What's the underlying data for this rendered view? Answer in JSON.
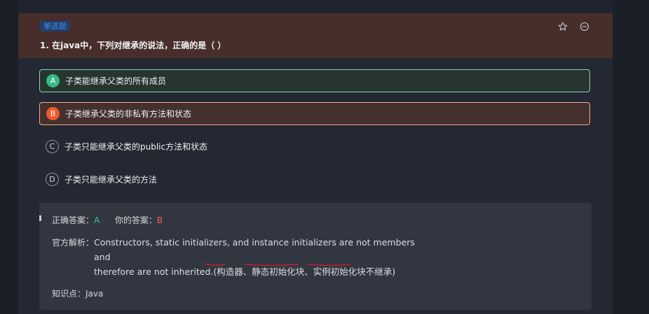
{
  "question": {
    "type_badge": "单选题",
    "title": "1. 在java中，下列对继承的说法，正确的是（ ）",
    "star_icon": "star-outline-icon",
    "remove_icon": "minus-circle-icon"
  },
  "options": [
    {
      "letter": "A",
      "text": "子类能继承父类的所有成员",
      "state": "correct"
    },
    {
      "letter": "B",
      "text": "子类继承父类的非私有方法和状态",
      "state": "selected-wrong"
    },
    {
      "letter": "C",
      "text": "子类只能继承父类的public方法和状态",
      "state": "default"
    },
    {
      "letter": "D",
      "text": "子类只能继承父类的方法",
      "state": "default"
    }
  ],
  "answer": {
    "correct_label": "正确答案：",
    "correct_value": "A",
    "yours_label": "你的答案：",
    "yours_value": "B",
    "explanation_label": "官方解析：",
    "explanation_line1": "Constructors, static initializers, and instance initializers are not members and",
    "explanation_line2": "therefore are not inherited.(构造器、静态初始化块、实例初始化块不继承)",
    "knowledge_label": "知识点：",
    "knowledge_value": "Java"
  },
  "colors": {
    "correct": "#36b887",
    "wrong": "#f2592b",
    "badge": "#3f8be8",
    "annotation": "#d0202a"
  }
}
